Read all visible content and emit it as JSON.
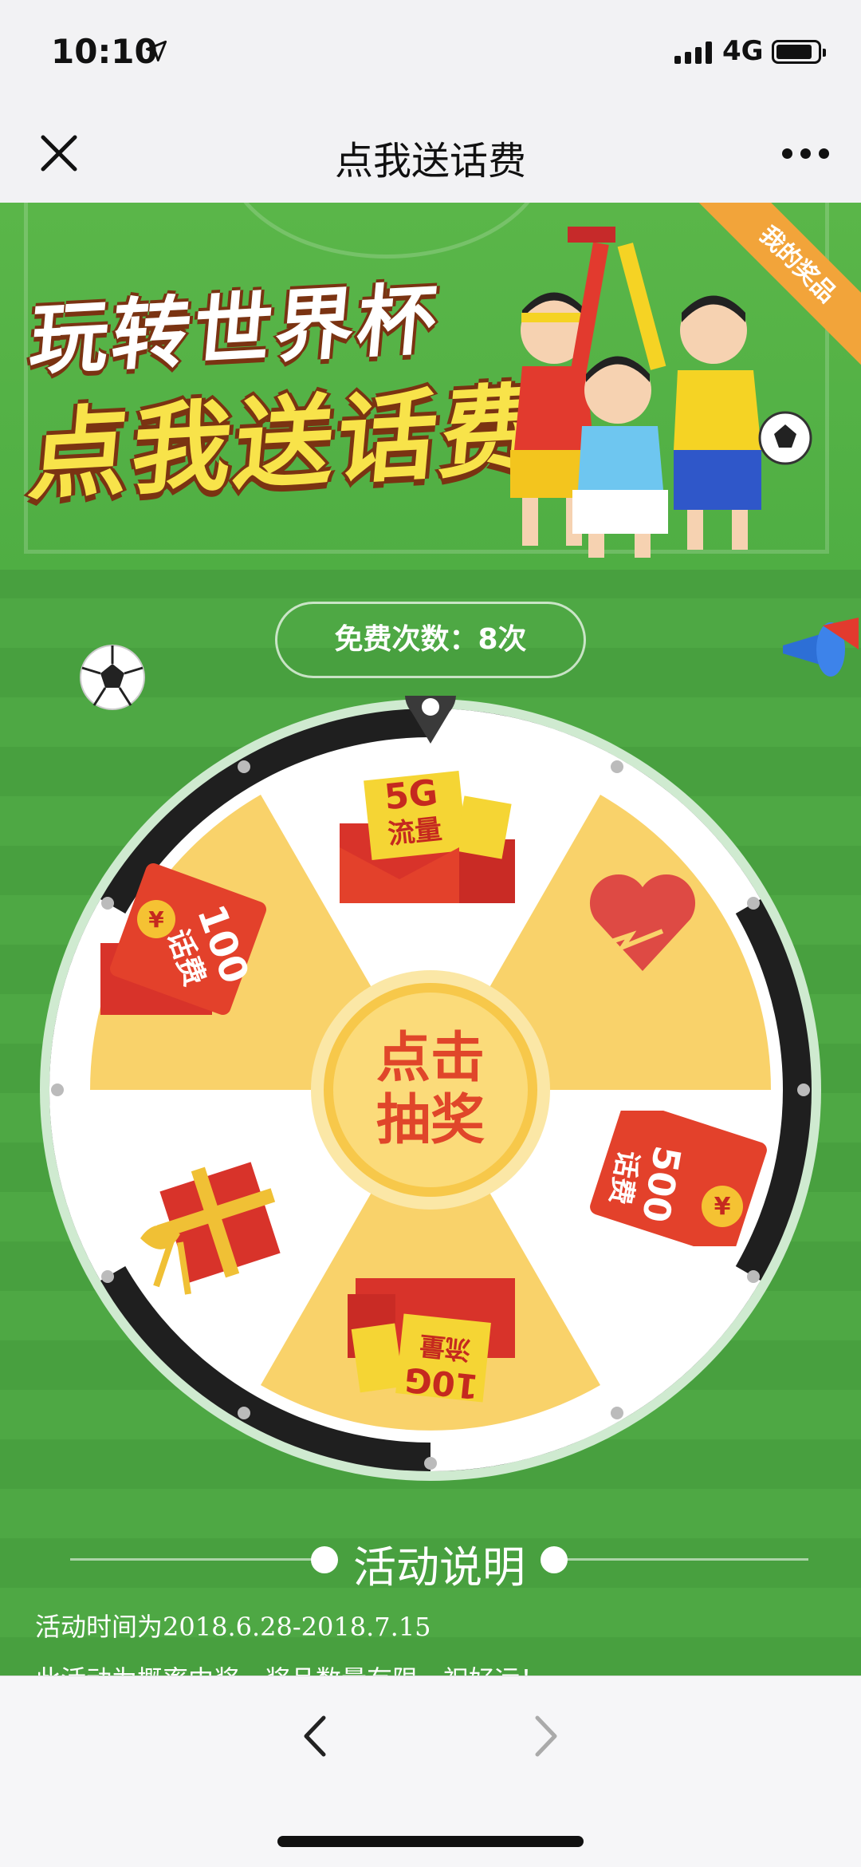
{
  "status": {
    "time": "10:10",
    "network": "4G",
    "icons": [
      "location-arrow-icon",
      "signal-icon",
      "battery-icon"
    ]
  },
  "nav": {
    "title": "点我送话费",
    "close_icon": "close-icon",
    "more_icon": "more-icon"
  },
  "banner": {
    "line1": "玩转世界杯",
    "line2": "点我送话费",
    "my_prizes": "我的奖品"
  },
  "free_count": "免费次数：8次",
  "wheel": {
    "center_line1": "点击",
    "center_line2": "抽奖",
    "prizes": [
      {
        "label_top": "5G",
        "label_bottom": "流量"
      },
      {
        "label_icon": "broken-heart-icon"
      },
      {
        "label_top": "500",
        "label_bottom": "话费"
      },
      {
        "label_top": "10G",
        "label_bottom": "流量"
      },
      {
        "label_icon": "gift-box-icon"
      },
      {
        "label_top": "100",
        "label_bottom": "话费"
      }
    ]
  },
  "section_title": "活动说明",
  "description": {
    "line1": "活动时间为2018.6.28-2018.7.15",
    "line2": "此活动为概率中奖，奖品数量有限，祝好运！"
  },
  "colors": {
    "green": "#4ea844",
    "yellow_slice": "#f9d26a",
    "red_envelope": "#e3412b",
    "accent_orange": "#f2a43a"
  }
}
